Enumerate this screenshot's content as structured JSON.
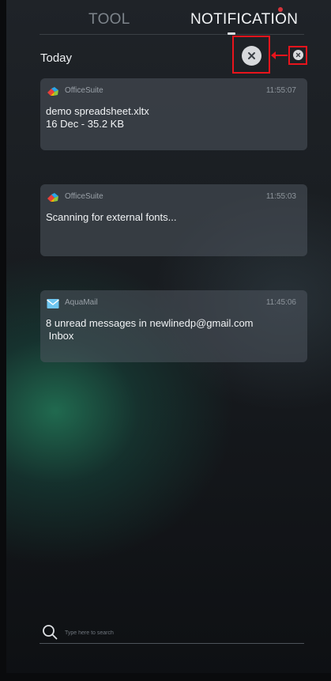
{
  "tabs": [
    {
      "label": "TOOL",
      "active": false
    },
    {
      "label": "NOTIFICATION",
      "active": true
    }
  ],
  "section": {
    "title": "Today"
  },
  "notifications": [
    {
      "app": "OfficeSuite",
      "icon": "officesuite-icon",
      "time": "11:55:07",
      "lines": [
        "demo spreadsheet.xltx",
        "16 Dec - 35.2 KB"
      ]
    },
    {
      "app": "OfficeSuite",
      "icon": "officesuite-icon",
      "time": "11:55:03",
      "lines": [
        "Scanning for external fonts...",
        ""
      ]
    },
    {
      "app": "AquaMail",
      "icon": "mail-icon",
      "time": "11:45:06",
      "lines": [
        "8 unread messages in newlinedp@gmail.com",
        " Inbox"
      ]
    }
  ],
  "search": {
    "placeholder": "Type here to search",
    "value": ""
  },
  "colors": {
    "accent_dot": "#d3333a",
    "annotation": "#e8141c",
    "card_bg": "#4e565e"
  }
}
